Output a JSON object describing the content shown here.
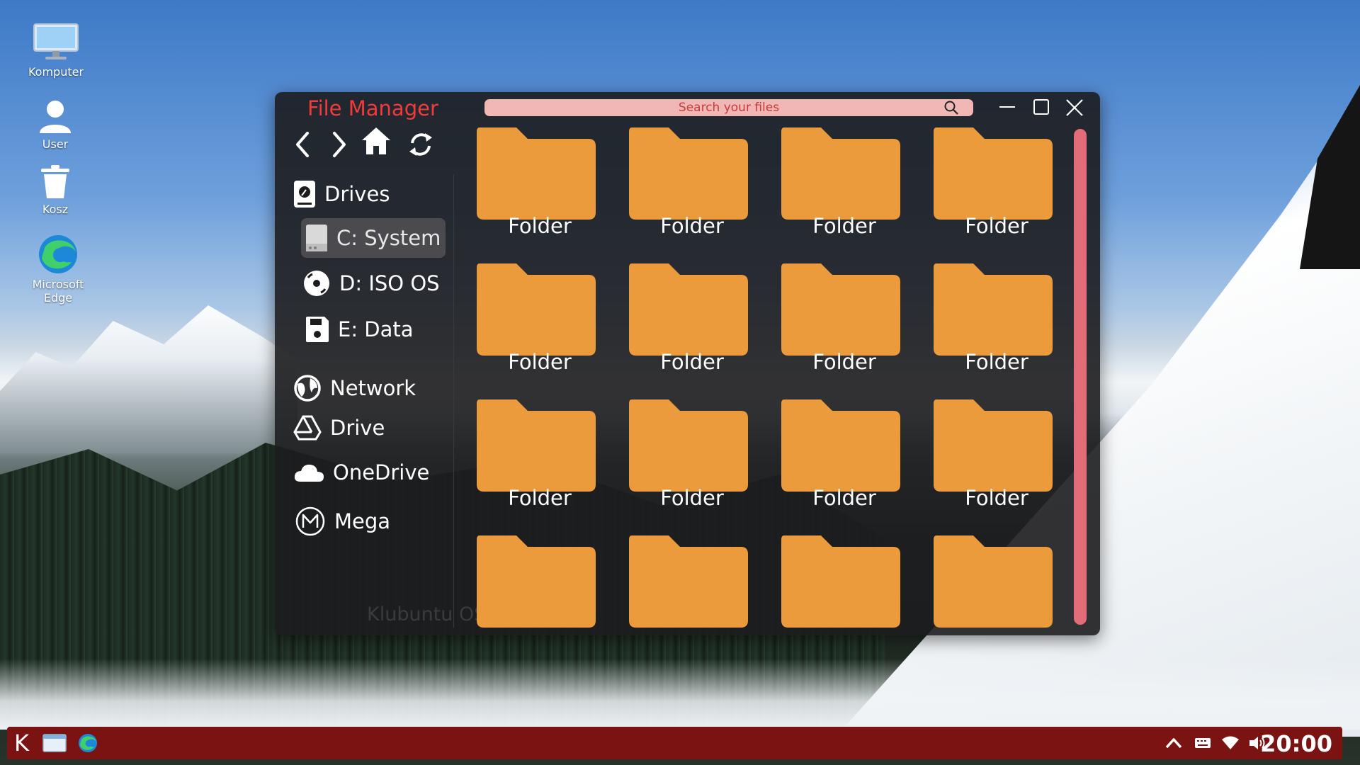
{
  "desktop": {
    "icons": [
      {
        "label": "Komputer"
      },
      {
        "label": "User"
      },
      {
        "label": "Kosz"
      },
      {
        "label": "Microsoft Edge"
      }
    ]
  },
  "window": {
    "title": "File Manager",
    "search_placeholder": "Search your files",
    "sidebar": {
      "drives_label": "Drives",
      "drives": [
        {
          "label": "C: System",
          "selected": true
        },
        {
          "label": "D: ISO OS"
        },
        {
          "label": "E: Data"
        }
      ],
      "network_label": "Network",
      "cloud": [
        {
          "label": "Drive"
        },
        {
          "label": "OneDrive"
        },
        {
          "label": "Mega"
        }
      ]
    },
    "folders": [
      {
        "label": "Folder"
      },
      {
        "label": "Folder"
      },
      {
        "label": "Folder"
      },
      {
        "label": "Folder"
      },
      {
        "label": "Folder"
      },
      {
        "label": "Folder"
      },
      {
        "label": "Folder"
      },
      {
        "label": "Folder"
      },
      {
        "label": "Folder"
      },
      {
        "label": "Folder"
      },
      {
        "label": "Folder"
      },
      {
        "label": "Folder"
      },
      {
        "label": ""
      },
      {
        "label": ""
      },
      {
        "label": ""
      },
      {
        "label": ""
      }
    ],
    "watermark": "Klubuntu OS v1"
  },
  "taskbar": {
    "start_label": "K",
    "clock": "20:00"
  },
  "colors": {
    "title": "#f23a3a",
    "folder": "#eb9a3c",
    "taskbar": "#7b1313",
    "search_bg": "#f1b7b4",
    "scrollbar": "#e26d78"
  }
}
